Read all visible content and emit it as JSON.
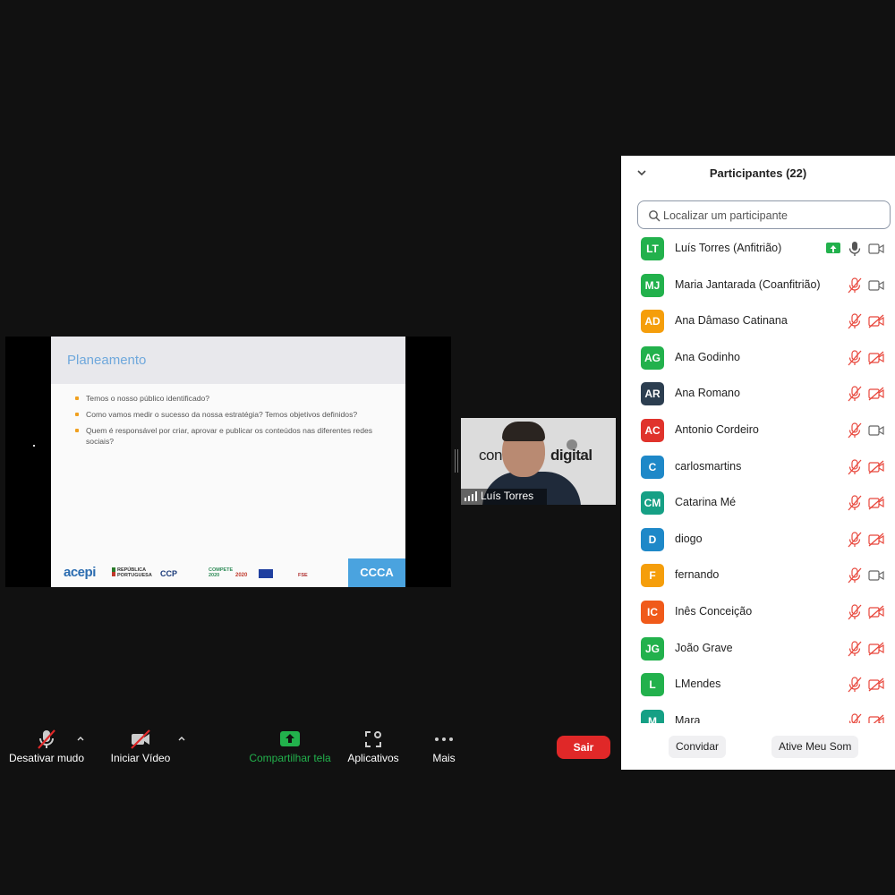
{
  "shared_slide": {
    "title": "Planeamento",
    "bullets": [
      "Temos o nosso público identificado?",
      "Como vamos medir o sucesso da nossa estratégia? Temos objetivos definidos?",
      "Quem é responsável por criar, aprovar e publicar os conteúdos nas diferentes redes sociais?"
    ],
    "footer_logos": {
      "acepi": "acepi",
      "republica": "REPÚBLICA PORTUGUESA",
      "ccp": "CCP",
      "compete": "COMPETE 2020",
      "p2020": "2020",
      "fse": "FSE",
      "box": "CCCA"
    }
  },
  "video_tile": {
    "name": "Luís Torres",
    "banner_left": "con",
    "banner_right": "digital"
  },
  "toolbar": {
    "mute_label": "Desativar mudo",
    "video_label": "Iniciar Vídeo",
    "share_label": "Compartilhar tela",
    "apps_label": "Aplicativos",
    "more_label": "Mais",
    "leave_label": "Sair",
    "share_color": "#22b14c",
    "leave_color": "#e02828"
  },
  "participants_panel": {
    "title": "Participantes (22)",
    "search_placeholder": "Localizar um participante",
    "participants": [
      {
        "initials": "LT",
        "name": "Luís Torres (Anfitrião)",
        "color": "#22b14c",
        "mic": "on",
        "video": "off",
        "sharing": true
      },
      {
        "initials": "MJ",
        "name": "Maria Jantarada (Coanfitrião)",
        "color": "#22b14c",
        "mic": "muted",
        "video": "off"
      },
      {
        "initials": "AD",
        "name": "Ana Dâmaso Catinana",
        "color": "#f59e0b",
        "mic": "muted",
        "video": "muted"
      },
      {
        "initials": "AG",
        "name": "Ana Godinho",
        "color": "#22b14c",
        "mic": "muted",
        "video": "muted"
      },
      {
        "initials": "AR",
        "name": "Ana Romano",
        "color": "#2c3e50",
        "mic": "muted",
        "video": "muted"
      },
      {
        "initials": "AC",
        "name": "Antonio Cordeiro",
        "color": "#e0332c",
        "mic": "muted",
        "video": "off"
      },
      {
        "initials": "C",
        "name": "carlosmartins",
        "color": "#1e88c8",
        "mic": "muted",
        "video": "muted"
      },
      {
        "initials": "CM",
        "name": "Catarina Mé",
        "color": "#16a085",
        "mic": "muted",
        "video": "muted"
      },
      {
        "initials": "D",
        "name": "diogo",
        "color": "#1e88c8",
        "mic": "muted",
        "video": "muted"
      },
      {
        "initials": "F",
        "name": "fernando",
        "color": "#f59e0b",
        "mic": "muted",
        "video": "off"
      },
      {
        "initials": "IC",
        "name": "Inês Conceição",
        "color": "#f05a1a",
        "mic": "muted",
        "video": "muted"
      },
      {
        "initials": "JG",
        "name": "João Grave",
        "color": "#22b14c",
        "mic": "muted",
        "video": "muted"
      },
      {
        "initials": "L",
        "name": "LMendes",
        "color": "#22b14c",
        "mic": "muted",
        "video": "muted"
      },
      {
        "initials": "M",
        "name": "Mara",
        "color": "#16a085",
        "mic": "muted",
        "video": "muted"
      }
    ],
    "invite_label": "Convidar",
    "unmute_me_label": "Ative Meu Som"
  }
}
